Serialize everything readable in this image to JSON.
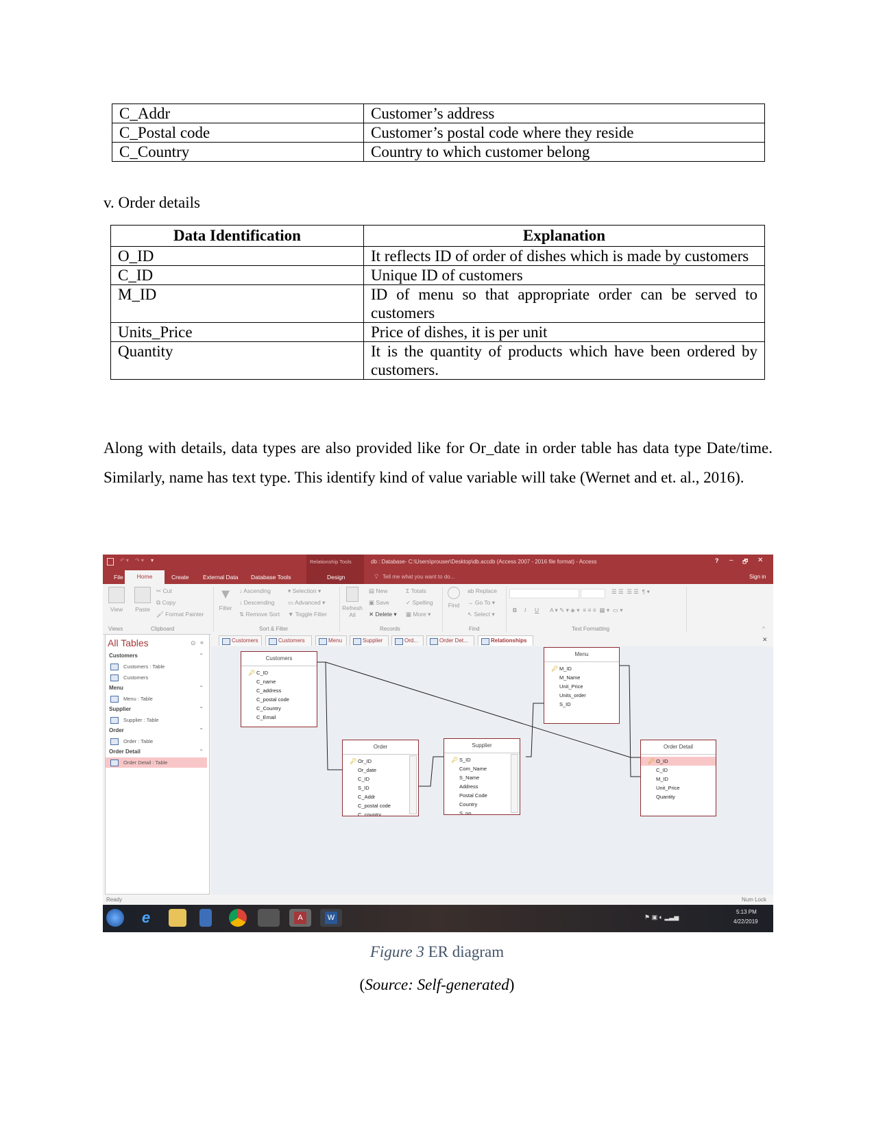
{
  "top_table": {
    "rows": [
      {
        "id": "C_Addr",
        "explanation": "Customer’s address"
      },
      {
        "id": "C_Postal code",
        "explanation": "Customer’s postal code where they reside"
      },
      {
        "id": "C_Country",
        "explanation": "Country to which customer belong"
      }
    ]
  },
  "section_heading": "v. Order details",
  "order_table": {
    "headers": [
      "Data Identification",
      "Explanation"
    ],
    "rows": [
      {
        "id": "O_ID",
        "explanation": "It reflects ID of order of dishes which is made by customers"
      },
      {
        "id": "C_ID",
        "explanation": "Unique ID of customers"
      },
      {
        "id": "M_ID",
        "explanation": "ID of menu so that appropriate order can be served to customers"
      },
      {
        "id": "Units_Price",
        "explanation": "Price of dishes, it is per unit"
      },
      {
        "id": "Quantity",
        "explanation": "It is the quantity of products which have been ordered by customers."
      }
    ]
  },
  "paragraph": "Along with details, data types are also provided like for Or_date in order table has data type Date/time. Similarly, name has text type. This identify kind of value variable will take (Wernet and et. al., 2016).",
  "figure": {
    "caption_label": "Figure 3",
    "caption_text": " ER diagram",
    "source_open": "(",
    "source_text": "Source: Self-generated",
    "source_close": ")"
  },
  "access": {
    "colors": {
      "brand": "#a4373a",
      "highlight": "#f8c6c7",
      "canvas": "#ebeef2"
    },
    "context_tab_group": "Relationship Tools",
    "window_title": "db : Database- C:\\Users\\prouser\\Desktop\\db.accdb (Access 2007 - 2016 file format) - Access",
    "window_controls": {
      "help": "?",
      "minimize": "–",
      "restore": "🗗",
      "close": "✕"
    },
    "ribbon_tabs": [
      "File",
      "Home",
      "Create",
      "External Data",
      "Database Tools",
      "Design"
    ],
    "active_ribbon_tab": "Home",
    "tell_me": "Tell me what you want to do...",
    "sign_in": "Sign in",
    "ribbon": {
      "views": {
        "label": "Views",
        "view": "View"
      },
      "clipboard": {
        "label": "Clipboard",
        "paste": "Paste",
        "cut": "Cut",
        "copy": "Copy",
        "format_painter": "Format Painter"
      },
      "sort_filter": {
        "label": "Sort & Filter",
        "filter": "Filter",
        "ascending": "Ascending",
        "descending": "Descending",
        "remove_sort": "Remove Sort",
        "selection": "Selection",
        "advanced": "Advanced",
        "toggle_filter": "Toggle Filter"
      },
      "records": {
        "label": "Records",
        "refresh": "Refresh All",
        "new": "New",
        "save": "Save",
        "delete": "Delete",
        "totals": "Totals",
        "spelling": "Spelling",
        "more": "More"
      },
      "find": {
        "label": "Find",
        "find": "Find",
        "replace": "Replace",
        "go_to": "Go To",
        "select": "Select"
      },
      "text_formatting": {
        "label": "Text Formatting",
        "bold": "B",
        "italic": "I",
        "underline": "U"
      }
    },
    "nav": {
      "title": "All Tables",
      "groups": [
        {
          "name": "Customers",
          "items": [
            "Customers : Table",
            "Customers"
          ]
        },
        {
          "name": "Menu",
          "items": [
            "Menu : Table"
          ]
        },
        {
          "name": "Supplier",
          "items": [
            "Supplier : Table"
          ]
        },
        {
          "name": "Order",
          "items": [
            "Order : Table"
          ]
        },
        {
          "name": "Order Detail",
          "items": [
            "Order Detail : Table"
          ]
        }
      ],
      "selected_item": "Order Detail : Table"
    },
    "doc_tabs": [
      "Customers",
      "Customers",
      "Menu",
      "Supplier",
      "Ord...",
      "Order Det...",
      "Relationships"
    ],
    "active_doc_tab": "Relationships",
    "er_tables": [
      {
        "name": "Customers",
        "fields": [
          "C_ID",
          "C_name",
          "C_address",
          "C_postal code",
          "C_Country",
          "C_Email"
        ],
        "key": "C_ID",
        "scroll": false
      },
      {
        "name": "Menu",
        "fields": [
          "M_ID",
          "M_Name",
          "Unit_Price",
          "Units_order",
          "S_ID"
        ],
        "key": "M_ID",
        "scroll": false
      },
      {
        "name": "Order",
        "fields": [
          "Or_ID",
          "Or_date",
          "C_ID",
          "S_ID",
          "C_Addr",
          "C_postal code",
          "C_country"
        ],
        "key": "Or_ID",
        "scroll": true
      },
      {
        "name": "Supplier",
        "fields": [
          "S_ID",
          "Com_Name",
          "S_Name",
          "Address",
          "Postal Code",
          "Country",
          "S_no"
        ],
        "key": "S_ID",
        "scroll": true
      },
      {
        "name": "Order Detail",
        "fields": [
          "O_ID",
          "C_ID",
          "M_ID",
          "Unit_Price",
          "Quantity"
        ],
        "key": "O_ID",
        "scroll": false,
        "highlight_key": true
      }
    ],
    "relationships": [
      [
        "Customers.C_ID",
        "Order.C_ID"
      ],
      [
        "Customers.C_ID",
        "Order Detail.C_ID"
      ],
      [
        "Menu.M_ID",
        "Order Detail.M_ID"
      ],
      [
        "Supplier.S_ID",
        "Menu.S_ID"
      ],
      [
        "Order.S_ID",
        "Supplier.S_ID"
      ]
    ],
    "status_left": "Ready",
    "status_right": "Num Lock",
    "taskbar": {
      "apps": [
        "start-icon",
        "internet-explorer-icon",
        "file-explorer-icon",
        "media-player-icon",
        "chrome-icon",
        "firefox-icon",
        "access-icon",
        "word-icon"
      ],
      "time": "5:13 PM",
      "date": "4/22/2019"
    }
  }
}
